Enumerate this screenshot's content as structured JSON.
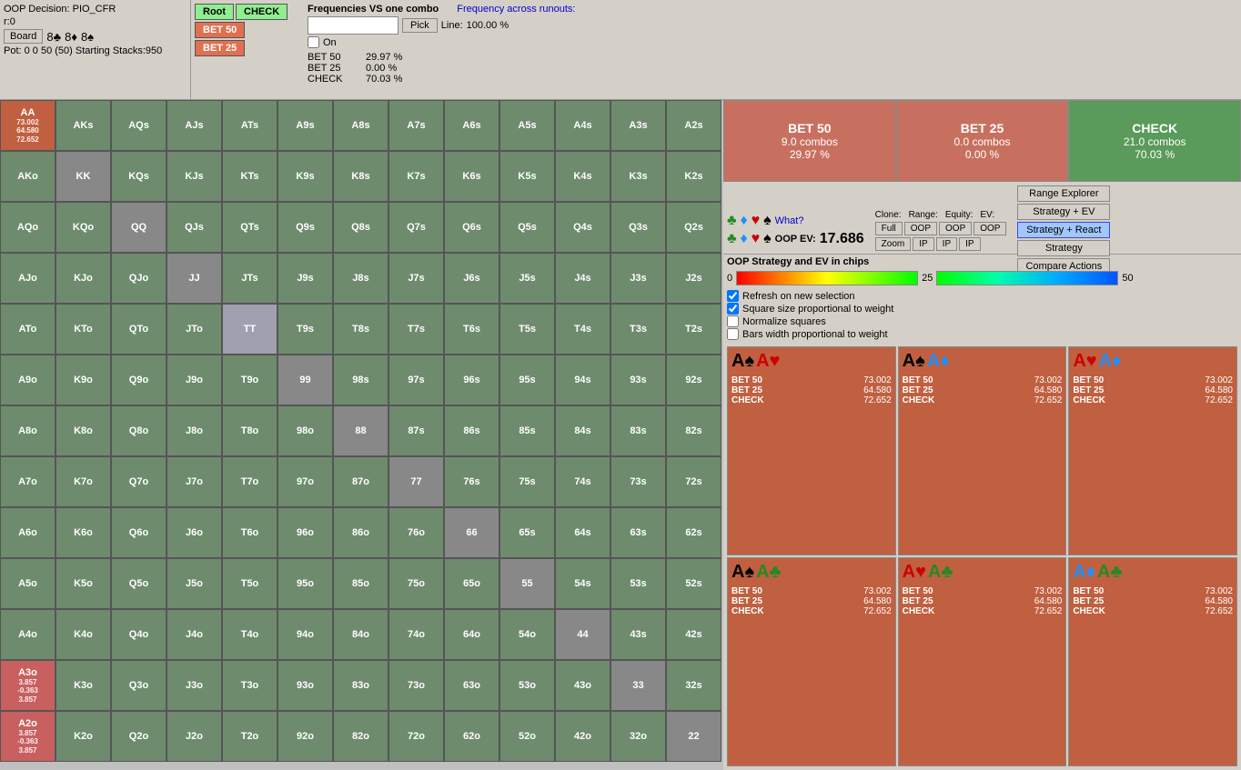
{
  "topbar": {
    "oop_decision": "OOP Decision: PIO_CFR",
    "r_label": "r:0",
    "board_btn": "Board",
    "cards": [
      "8♣",
      "8♦",
      "8♠"
    ],
    "pot_info": "Pot: 0 0 50 (50) Starting Stacks:950",
    "tree": {
      "root_label": "Root",
      "check_label": "CHECK",
      "bet50_label": "BET 50",
      "bet25_label": "BET 25"
    }
  },
  "freq_panel": {
    "title": "Frequencies VS one combo",
    "link": "Frequency across runouts:",
    "pick_placeholder": "",
    "pick_btn": "Pick",
    "line_label": "Line:",
    "line_value": "100.00 %",
    "on_label": "On",
    "stats": [
      {
        "label": "BET 50",
        "value": "29.97 %"
      },
      {
        "label": "BET 25",
        "value": "0.00 %"
      },
      {
        "label": "CHECK",
        "value": "70.03 %"
      }
    ]
  },
  "action_summary": {
    "bet50": {
      "title": "BET 50",
      "combos": "9.0 combos",
      "pct": "29.97 %"
    },
    "bet25": {
      "title": "BET 25",
      "combos": "0.0 combos",
      "pct": "0.00 %"
    },
    "check": {
      "title": "CHECK",
      "combos": "21.0 combos",
      "pct": "70.03 %"
    }
  },
  "ev_section": {
    "what_label": "What?",
    "oop_ev_label": "OOP EV:",
    "oop_ev_value": "17.686",
    "oop_strategy_label": "OOP Strategy and EV in chips",
    "clone_label": "Clone:",
    "range_label": "Range:",
    "equity_label": "Equity:",
    "ev_label": "EV:",
    "buttons": {
      "full": "Full",
      "oop1": "OOP",
      "oop2": "OOP",
      "oop3": "OOP",
      "zoom": "Zoom",
      "ip1": "IP",
      "ip2": "IP",
      "ip3": "IP",
      "range_explorer": "Range Explorer",
      "strategy_ev": "Strategy + EV",
      "strategy_react": "Strategy + React",
      "strategy": "Strategy",
      "compare": "Compare Actions"
    },
    "ev_scale": {
      "min": "0",
      "mid": "25",
      "max": "50"
    },
    "checkboxes": [
      {
        "label": "Refresh on new selection",
        "checked": true
      },
      {
        "label": "Square size proportional to weight",
        "checked": true
      },
      {
        "label": "Normalize squares",
        "checked": false
      },
      {
        "label": "Bars width proportional to weight",
        "checked": false
      }
    ]
  },
  "card_grid": [
    {
      "suit1": "♠",
      "suit1_class": "spade",
      "rank1": "A",
      "suit2": "♥",
      "suit2_class": "heart",
      "rank2": "A",
      "stats": [
        {
          "label": "BET 50",
          "value": "73.002"
        },
        {
          "label": "BET 25",
          "value": "64.580"
        },
        {
          "label": "CHECK",
          "value": "72.652"
        }
      ]
    },
    {
      "suit1": "♠",
      "suit1_class": "spade",
      "rank1": "A",
      "suit2": "♦",
      "suit2_class": "diamond",
      "rank2": "A",
      "stats": [
        {
          "label": "BET 50",
          "value": "73.002"
        },
        {
          "label": "BET 25",
          "value": "64.580"
        },
        {
          "label": "CHECK",
          "value": "72.652"
        }
      ]
    },
    {
      "suit1": "♥",
      "suit1_class": "heart",
      "rank1": "A",
      "suit2": "♦",
      "suit2_class": "diamond",
      "rank2": "A",
      "stats": [
        {
          "label": "BET 50",
          "value": "73.002"
        },
        {
          "label": "BET 25",
          "value": "64.580"
        },
        {
          "label": "CHECK",
          "value": "72.652"
        }
      ]
    },
    {
      "suit1": "♠",
      "suit1_class": "spade",
      "rank1": "A",
      "suit2": "♣",
      "suit2_class": "club",
      "rank2": "A",
      "stats": [
        {
          "label": "BET 50",
          "value": "73.002"
        },
        {
          "label": "BET 25",
          "value": "64.580"
        },
        {
          "label": "CHECK",
          "value": "72.652"
        }
      ]
    },
    {
      "suit1": "♥",
      "suit1_class": "heart",
      "rank1": "A",
      "suit2": "♣",
      "suit2_class": "club",
      "rank2": "A",
      "stats": [
        {
          "label": "BET 50",
          "value": "73.002"
        },
        {
          "label": "BET 25",
          "value": "64.580"
        },
        {
          "label": "CHECK",
          "value": "72.652"
        }
      ]
    },
    {
      "suit1": "♦",
      "suit1_class": "diamond",
      "rank1": "A",
      "suit2": "♣",
      "suit2_class": "club",
      "rank2": "A",
      "stats": [
        {
          "label": "BET 50",
          "value": "73.002"
        },
        {
          "label": "BET 25",
          "value": "64.580"
        },
        {
          "label": "CHECK",
          "value": "72.652"
        }
      ]
    }
  ],
  "matrix": {
    "headers": [
      "AA",
      "AKs",
      "AQs",
      "AJs",
      "ATs",
      "A9s",
      "A8s",
      "A7s",
      "A6s",
      "A5s",
      "A4s",
      "A3s",
      "A2s"
    ],
    "rows": [
      {
        "label": "AA",
        "vals": [
          "AA",
          "AKs",
          "AQs",
          "AJs",
          "ATs",
          "A9s",
          "A8s",
          "A7s",
          "A6s",
          "A5s",
          "A4s",
          "A3s",
          "A2s"
        ],
        "type": "row0"
      },
      {
        "label": "AKo",
        "vals": [
          "AKo",
          "KK",
          "KQs",
          "KJs",
          "KTs",
          "K9s",
          "K8s",
          "K7s",
          "K6s",
          "K5s",
          "K4s",
          "K3s",
          "K2s"
        ],
        "type": "row1"
      },
      {
        "label": "AQo",
        "vals": [
          "AQo",
          "KQo",
          "QQ",
          "QJs",
          "QTs",
          "Q9s",
          "Q8s",
          "Q7s",
          "Q6s",
          "Q5s",
          "Q4s",
          "Q3s",
          "Q2s"
        ],
        "type": "row2"
      },
      {
        "label": "AJo",
        "vals": [
          "AJo",
          "KJo",
          "QJo",
          "JJ",
          "JTs",
          "J9s",
          "J8s",
          "J7s",
          "J6s",
          "J5s",
          "J4s",
          "J3s",
          "J2s"
        ],
        "type": "row3"
      },
      {
        "label": "ATo",
        "vals": [
          "ATo",
          "KTo",
          "QTo",
          "JTo",
          "TT",
          "T9s",
          "T8s",
          "T7s",
          "T6s",
          "T5s",
          "T4s",
          "T3s",
          "T2s"
        ],
        "type": "row4"
      },
      {
        "label": "A9o",
        "vals": [
          "A9o",
          "K9o",
          "Q9o",
          "J9o",
          "T9o",
          "99",
          "98s",
          "97s",
          "96s",
          "95s",
          "94s",
          "93s",
          "92s"
        ],
        "type": "row5"
      },
      {
        "label": "A8o",
        "vals": [
          "A8o",
          "K8o",
          "Q8o",
          "J8o",
          "T8o",
          "98o",
          "88",
          "87s",
          "86s",
          "85s",
          "84s",
          "83s",
          "82s"
        ],
        "type": "row6"
      },
      {
        "label": "A7o",
        "vals": [
          "A7o",
          "K7o",
          "Q7o",
          "J7o",
          "T7o",
          "97o",
          "87o",
          "77",
          "76s",
          "75s",
          "74s",
          "73s",
          "72s"
        ],
        "type": "row7"
      },
      {
        "label": "A6o",
        "vals": [
          "A6o",
          "K6o",
          "Q6o",
          "J6o",
          "T6o",
          "96o",
          "86o",
          "76o",
          "66",
          "65s",
          "64s",
          "63s",
          "62s"
        ],
        "type": "row8"
      },
      {
        "label": "A5o",
        "vals": [
          "A5o",
          "K5o",
          "Q5o",
          "J5o",
          "T5o",
          "95o",
          "85o",
          "75o",
          "65o",
          "55",
          "54s",
          "53s",
          "52s"
        ],
        "type": "row9"
      },
      {
        "label": "A4o",
        "vals": [
          "A4o",
          "K4o",
          "Q4o",
          "J4o",
          "T4o",
          "94o",
          "84o",
          "74o",
          "64o",
          "54o",
          "44",
          "43s",
          "42s"
        ],
        "type": "row10"
      },
      {
        "label": "A3o",
        "vals": [
          "A3o",
          "K3o",
          "Q3o",
          "J3o",
          "T3o",
          "93o",
          "83o",
          "73o",
          "63o",
          "53o",
          "43o",
          "33",
          "32s"
        ],
        "type": "row11"
      },
      {
        "label": "A2o",
        "vals": [
          "A2o",
          "K2o",
          "Q2o",
          "J2o",
          "T2o",
          "92o",
          "82o",
          "72o",
          "62o",
          "52o",
          "42o",
          "32o",
          "22"
        ],
        "type": "row12"
      }
    ]
  }
}
